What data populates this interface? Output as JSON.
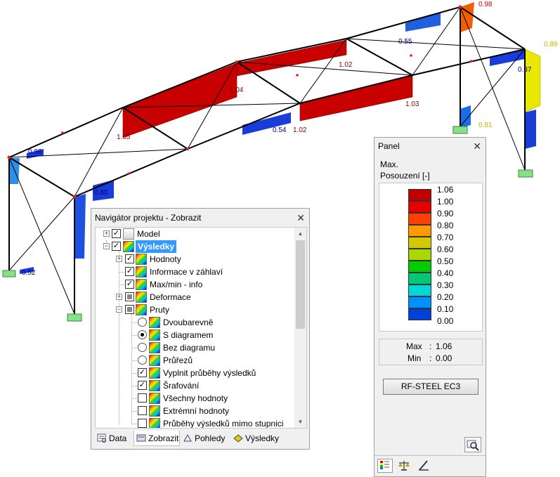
{
  "viewport": {
    "value_labels": [
      "0.98",
      "0.55",
      "0.89",
      "0.87",
      "1.02",
      "1.04",
      "1.03",
      "1.05",
      "0.54",
      "1.02",
      "0.86",
      "0.80",
      "0.81",
      "0.52"
    ],
    "colors": {
      "beam": "#000000",
      "red_diagram": "#c80000",
      "max_label": "#d00000",
      "blue_label": "#000080",
      "yellow_label": "#c8c800",
      "support": "#88e088"
    }
  },
  "navigator": {
    "title": "Navigátor projektu - Zobrazit",
    "close": "✕",
    "items": [
      {
        "label": "Model",
        "checked": true,
        "expand": "+"
      },
      {
        "label": "Výsledky",
        "checked": true,
        "expand": "−",
        "selected": true
      },
      {
        "label": "Hodnoty",
        "checked": true,
        "expand": "+"
      },
      {
        "label": "Informace v záhlaví",
        "checked": true
      },
      {
        "label": "Max/min - info",
        "checked": true
      },
      {
        "label": "Deformace",
        "checked": "partial",
        "expand": "+"
      },
      {
        "label": "Pruty",
        "checked": "partial",
        "expand": "−"
      },
      {
        "label": "Dvoubarevně",
        "radio": false
      },
      {
        "label": "S diagramem",
        "radio": true
      },
      {
        "label": "Bez diagramu",
        "radio": false
      },
      {
        "label": "Průřezů",
        "radio": false
      },
      {
        "label": "Vyplnit průběhy výsledků",
        "checked": true
      },
      {
        "label": "Šrafování",
        "checked": true
      },
      {
        "label": "Všechny hodnoty",
        "checked": false
      },
      {
        "label": "Extrémní hodnoty",
        "checked": false
      },
      {
        "label": "Průběhy výsledků mimo stupnici",
        "checked": false
      }
    ],
    "tabs": [
      {
        "label": "Data",
        "active": false
      },
      {
        "label": "Zobrazit",
        "active": true
      },
      {
        "label": "Pohledy",
        "active": false
      },
      {
        "label": "Výsledky",
        "active": false
      }
    ]
  },
  "panel": {
    "title": "Panel",
    "close": "✕",
    "header_line1": "Max.",
    "header_line2": "Posouzení [-]",
    "legend": [
      {
        "value": "1.06",
        "color": "#c00000"
      },
      {
        "value": "1.00",
        "color": "#e80000"
      },
      {
        "value": "0.90",
        "color": "#ff4000"
      },
      {
        "value": "0.80",
        "color": "#ff9900"
      },
      {
        "value": "0.70",
        "color": "#d4c800"
      },
      {
        "value": "0.60",
        "color": "#a8d800"
      },
      {
        "value": "0.50",
        "color": "#00cc00"
      },
      {
        "value": "0.40",
        "color": "#00c878"
      },
      {
        "value": "0.30",
        "color": "#00d8d8"
      },
      {
        "value": "0.20",
        "color": "#0090ff"
      },
      {
        "value": "0.10",
        "color": "#0040d8"
      },
      {
        "value": "0.00",
        "color": "#00008c"
      }
    ],
    "max_label": "Max",
    "max_sep": ":",
    "max_value": "1.06",
    "min_label": "Min",
    "min_sep": ":",
    "min_value": "0.00",
    "button_label": "RF-STEEL EC3",
    "bottom_icons": [
      "color-scale-icon",
      "balance-icon",
      "pen-icon"
    ]
  }
}
